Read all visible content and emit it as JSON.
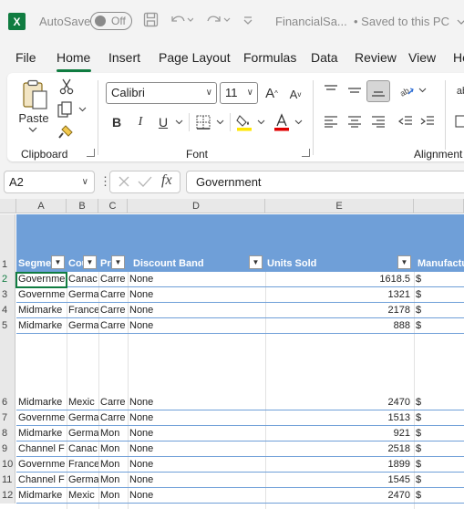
{
  "titlebar": {
    "logo": "X",
    "autosave_label": "AutoSave",
    "autosave_state": "Off",
    "file_name": "FinancialSa...",
    "save_status": "• Saved to this PC",
    "icons": [
      "save-icon",
      "undo-icon",
      "redo-icon",
      "customize-icon"
    ]
  },
  "tabs": [
    "File",
    "Home",
    "Insert",
    "Page Layout",
    "Formulas",
    "Data",
    "Review",
    "View",
    "He"
  ],
  "active_tab": "Home",
  "ribbon": {
    "clipboard": {
      "label": "Clipboard",
      "paste": "Paste"
    },
    "font": {
      "label": "Font",
      "name": "Calibri",
      "size": "11",
      "bold": "B",
      "italic": "I",
      "underline": "U",
      "grow": "A",
      "shrink": "A",
      "fill_color": "#ffe600",
      "font_color": "#e00000"
    },
    "alignment": {
      "label": "Alignment",
      "wrap_partial": "ab"
    }
  },
  "formula_bar": {
    "name_box": "A2",
    "fx": "fx",
    "value": "Government"
  },
  "sheet": {
    "columns": [
      "A",
      "B",
      "C",
      "D",
      "E"
    ],
    "headers": [
      "Segme",
      "Cou",
      "Pr",
      "Discount Band",
      "Units Sold",
      "Manufactu"
    ],
    "rows": [
      {
        "num": "2",
        "a": "Governme",
        "b": "Canac",
        "c": "Carre",
        "d": "None",
        "e": "1618.5",
        "f": "$"
      },
      {
        "num": "3",
        "a": "Governme",
        "b": "Germa",
        "c": "Carre",
        "d": "None",
        "e": "1321",
        "f": "$"
      },
      {
        "num": "4",
        "a": "Midmarke",
        "b": "France",
        "c": "Carre",
        "d": "None",
        "e": "2178",
        "f": "$"
      },
      {
        "num": "5",
        "a": "Midmarke",
        "b": "Germa",
        "c": "Carre",
        "d": "None",
        "e": "888",
        "f": "$"
      },
      {
        "num": "6",
        "a": "Midmarke",
        "b": "Mexic",
        "c": "Carre",
        "d": "None",
        "e": "2470",
        "f": "$"
      },
      {
        "num": "7",
        "a": "Governme",
        "b": "Germa",
        "c": "Carre",
        "d": "None",
        "e": "1513",
        "f": "$"
      },
      {
        "num": "8",
        "a": "Midmarke",
        "b": "Germa",
        "c": "Mon",
        "d": "None",
        "e": "921",
        "f": "$"
      },
      {
        "num": "9",
        "a": "Channel F",
        "b": "Canac",
        "c": "Mon",
        "d": "None",
        "e": "2518",
        "f": "$"
      },
      {
        "num": "10",
        "a": "Governme",
        "b": "France",
        "c": "Mon",
        "d": "None",
        "e": "1899",
        "f": "$"
      },
      {
        "num": "11",
        "a": "Channel F",
        "b": "Germa",
        "c": "Mon",
        "d": "None",
        "e": "1545",
        "f": "$"
      },
      {
        "num": "12",
        "a": "Midmarke",
        "b": "Mexic",
        "c": "Mon",
        "d": "None",
        "e": "2470",
        "f": "$"
      }
    ],
    "header_row_num": "1",
    "accent": "#107c41",
    "table_color": "#6f9fd8"
  }
}
